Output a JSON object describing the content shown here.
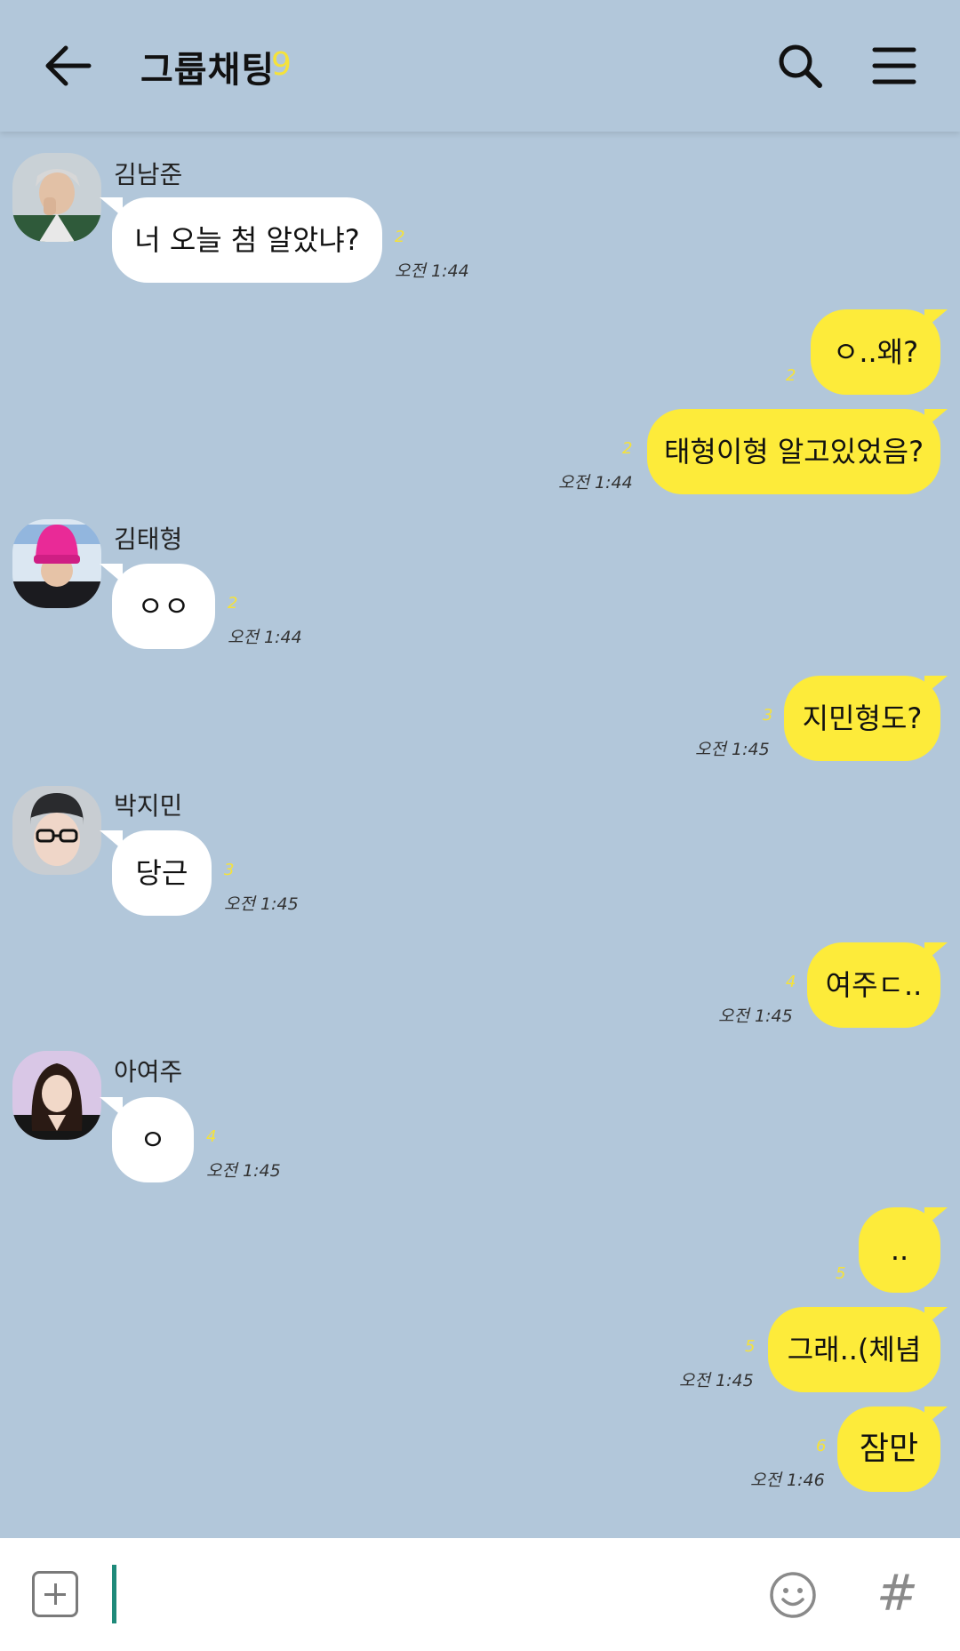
{
  "header": {
    "title": "그룹채팅",
    "member_count": "9",
    "back_icon": "back-arrow-icon",
    "search_icon": "search-icon",
    "menu_icon": "menu-icon"
  },
  "messages": [
    {
      "side": "in",
      "sender": "김남준",
      "avatar": "avatar-namjoon",
      "text": "너 오늘 첨 알았냐?",
      "unread": "2",
      "time": "오전 1:44"
    },
    {
      "side": "out",
      "text": "ㅇ..왜?",
      "unread": "2",
      "time": ""
    },
    {
      "side": "out",
      "text": "태형이형 알고있었음?",
      "unread": "2",
      "time": "오전 1:44"
    },
    {
      "side": "in",
      "sender": "김태형",
      "avatar": "avatar-taehyung",
      "text": "ㅇㅇ",
      "unread": "2",
      "time": "오전 1:44"
    },
    {
      "side": "out",
      "text": "지민형도?",
      "unread": "3",
      "time": "오전 1:45"
    },
    {
      "side": "in",
      "sender": "박지민",
      "avatar": "avatar-jimin",
      "text": "당근",
      "unread": "3",
      "time": "오전 1:45"
    },
    {
      "side": "out",
      "text": "여주ㄷ..",
      "unread": "4",
      "time": "오전 1:45"
    },
    {
      "side": "in",
      "sender": "아여주",
      "avatar": "avatar-yeoju",
      "text": "ㅇ",
      "unread": "4",
      "time": "오전 1:45"
    },
    {
      "side": "out",
      "text": "..",
      "unread": "5",
      "time": ""
    },
    {
      "side": "out",
      "text": "그래..(체념",
      "unread": "5",
      "time": "오전 1:45"
    },
    {
      "side": "out",
      "text": "잠만",
      "unread": "6",
      "time": "오전 1:46"
    }
  ],
  "input": {
    "value": "",
    "plus_icon": "plus-box-icon",
    "emoji_icon": "smiley-icon",
    "hash_label": "#"
  }
}
